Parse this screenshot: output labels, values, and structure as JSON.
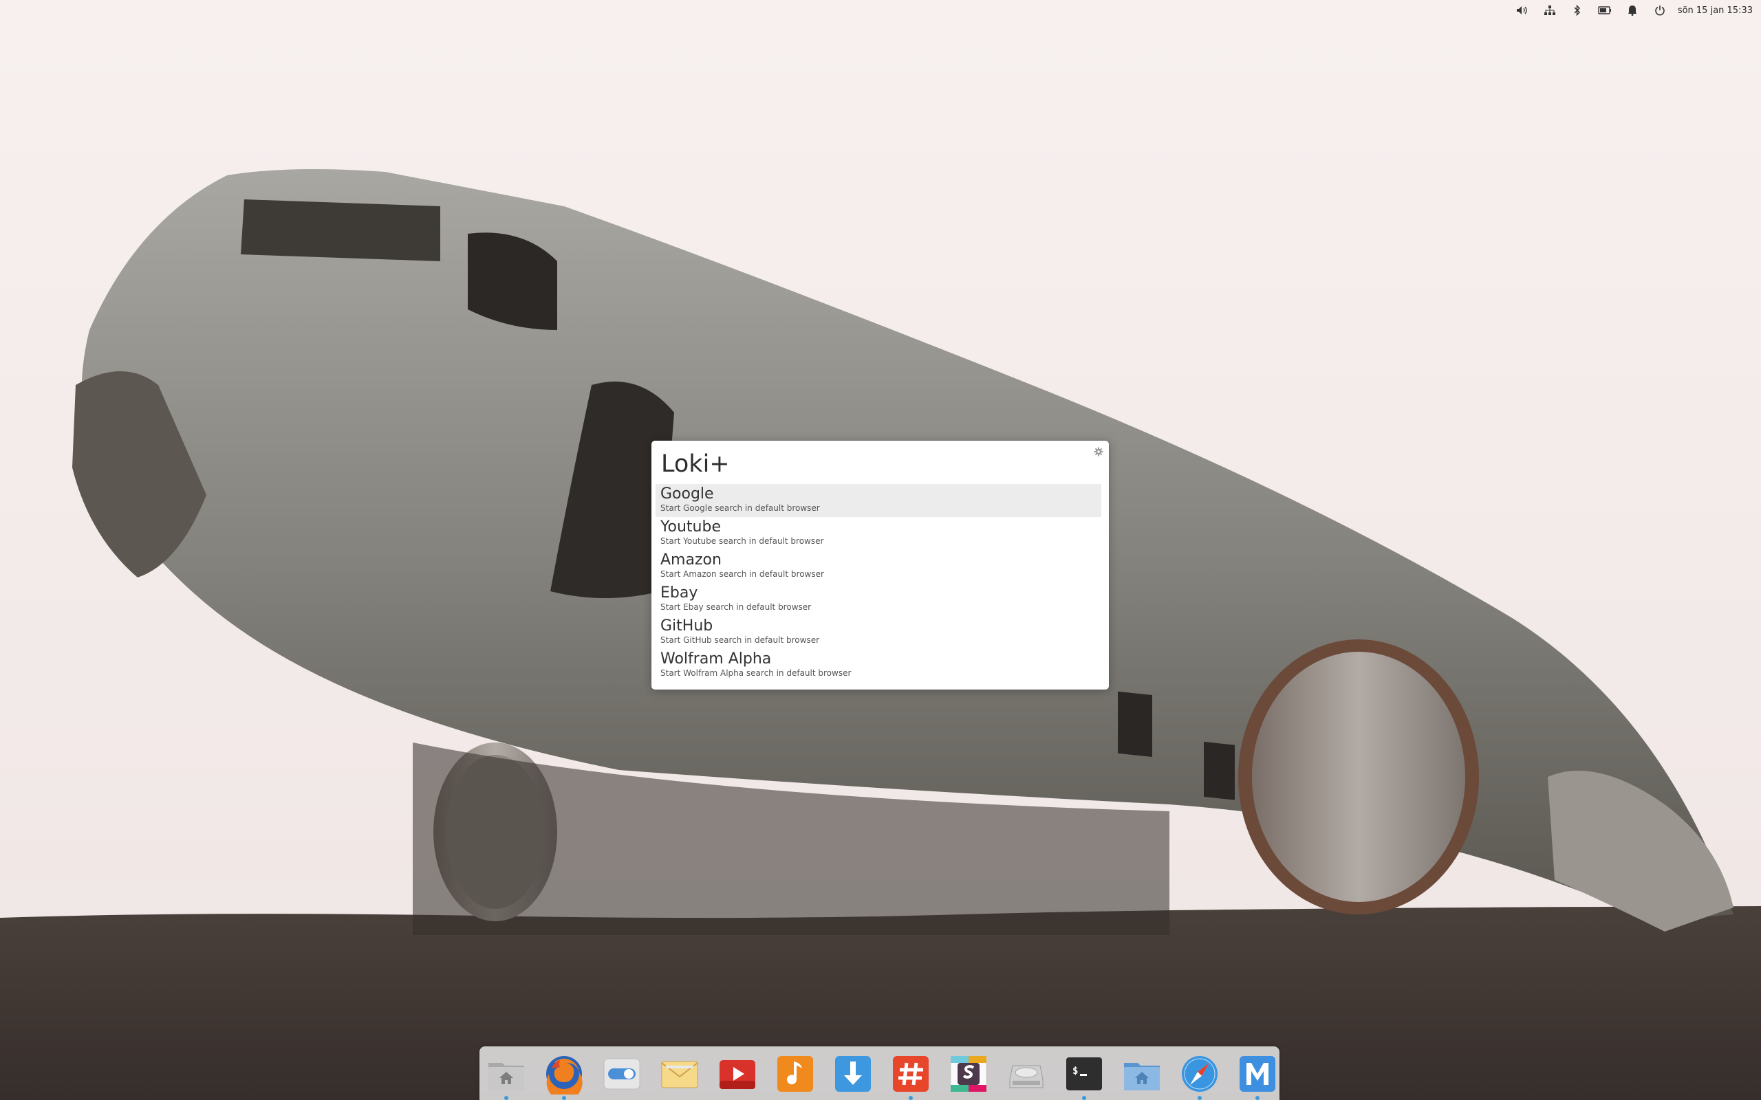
{
  "panel": {
    "indicators": [
      {
        "name": "volume-icon"
      },
      {
        "name": "network-icon"
      },
      {
        "name": "bluetooth-icon"
      },
      {
        "name": "battery-icon"
      },
      {
        "name": "notifications-icon"
      },
      {
        "name": "power-icon"
      }
    ],
    "datetime": "sön 15 jan  15:33"
  },
  "launcher": {
    "query": "Loki+",
    "settings_icon": "gear-icon",
    "results": [
      {
        "title": "Google",
        "description": "Start Google search in default browser",
        "selected": true
      },
      {
        "title": "Youtube",
        "description": "Start Youtube search in default browser",
        "selected": false
      },
      {
        "title": "Amazon",
        "description": "Start Amazon search in default browser",
        "selected": false
      },
      {
        "title": "Ebay",
        "description": "Start Ebay search in default browser",
        "selected": false
      },
      {
        "title": "GitHub",
        "description": "Start GitHub search in default browser",
        "selected": false
      },
      {
        "title": "Wolfram Alpha",
        "description": "Start Wolfram Alpha search in default browser",
        "selected": false
      }
    ]
  },
  "dock": {
    "items": [
      {
        "name": "home-folder-icon",
        "running": true
      },
      {
        "name": "firefox-icon",
        "running": true
      },
      {
        "name": "system-settings-icon",
        "running": false
      },
      {
        "name": "mail-icon",
        "running": false
      },
      {
        "name": "videos-icon",
        "running": false
      },
      {
        "name": "music-icon",
        "running": false
      },
      {
        "name": "appcenter-icon",
        "running": false
      },
      {
        "name": "hashtag-app-icon",
        "running": true
      },
      {
        "name": "slack-icon",
        "running": false
      },
      {
        "name": "disk-drive-icon",
        "running": false
      },
      {
        "name": "terminal-icon",
        "running": true
      },
      {
        "name": "home-folder-icon",
        "running": false
      },
      {
        "name": "compass-browser-icon",
        "running": true
      },
      {
        "name": "mail-m-icon",
        "running": true
      }
    ]
  },
  "colors": {
    "sky": "#f6efee",
    "ground": "#3f3632",
    "accent": "#3a9bdc"
  }
}
